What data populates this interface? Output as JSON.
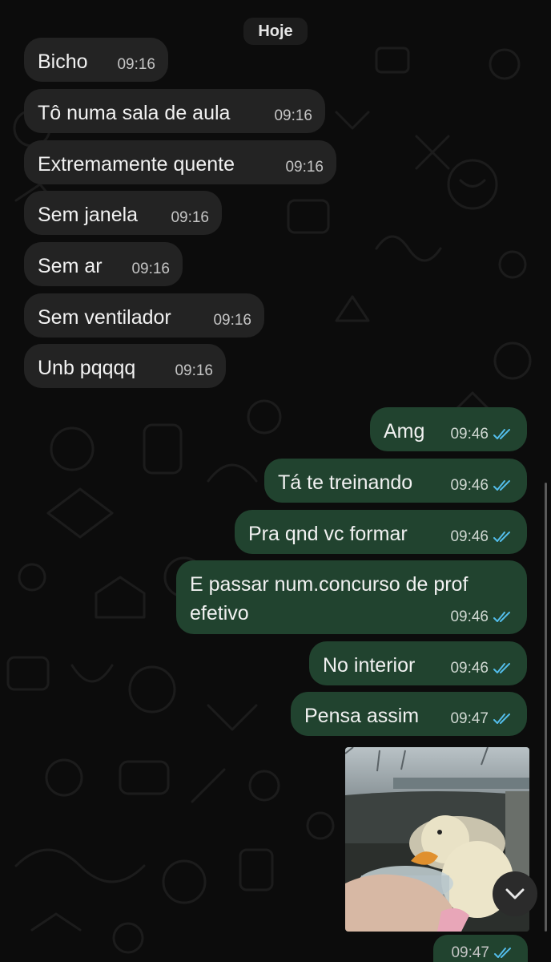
{
  "date_separator": "Hoje",
  "incoming": [
    {
      "text": "Bicho",
      "time": "09:16"
    },
    {
      "text": "Tô numa sala de aula",
      "time": "09:16"
    },
    {
      "text": "Extremamente quente",
      "time": "09:16"
    },
    {
      "text": "Sem janela",
      "time": "09:16"
    },
    {
      "text": "Sem ar",
      "time": "09:16"
    },
    {
      "text": "Sem ventilador",
      "time": "09:16"
    },
    {
      "text": "Unb pqqqq",
      "time": "09:16"
    }
  ],
  "outgoing": [
    {
      "text": "Amg",
      "time": "09:46"
    },
    {
      "text": "Tá te treinando",
      "time": "09:46"
    },
    {
      "text": "Pra qnd vc formar",
      "time": "09:46"
    },
    {
      "text": "E passar num.concurso de prof efetivo",
      "time": "09:46"
    },
    {
      "text": "No interior",
      "time": "09:46"
    },
    {
      "text": "Pensa assim",
      "time": "09:47"
    }
  ],
  "last_outgoing_time": "09:47",
  "colors": {
    "incoming_bubble": "#232323",
    "outgoing_bubble": "#21432f",
    "read_ticks": "#53bdeb",
    "background": "#0c0c0c"
  },
  "icons": {
    "read_receipt": "double-check-icon",
    "scroll_down": "chevron-down-icon"
  }
}
